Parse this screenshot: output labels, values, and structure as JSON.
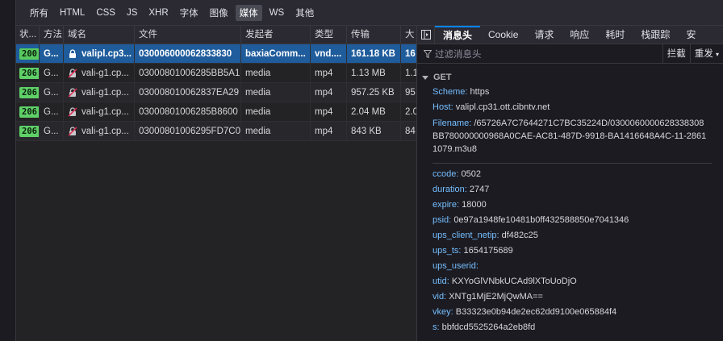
{
  "filters": [
    "所有",
    "HTML",
    "CSS",
    "JS",
    "XHR",
    "字体",
    "图像",
    "媒体",
    "WS",
    "其他"
  ],
  "active_filter": "媒体",
  "table": {
    "headers": [
      "状...",
      "方法",
      "域名",
      "文件",
      "发起者",
      "类型",
      "传输",
      "大"
    ],
    "rows": [
      {
        "status": "200",
        "method": "G...",
        "host": "valipl.cp3...",
        "file": "030006000062833830",
        "initiator": "baxiaComm...",
        "type": "vnd....",
        "transfer": "161.18 KB",
        "size": "16",
        "host_icon": "lock-icon",
        "selected": true
      },
      {
        "status": "206",
        "method": "G...",
        "host": "vali-g1.cp...",
        "file": "03000801006285BB5A1",
        "initiator": "media",
        "type": "mp4",
        "transfer": "1.13 MB",
        "size": "1.1",
        "host_icon": "insecure-lock-icon",
        "selected": false
      },
      {
        "status": "206",
        "method": "G...",
        "host": "vali-g1.cp...",
        "file": "030008010062837EA29",
        "initiator": "media",
        "type": "mp4",
        "transfer": "957.25 KB",
        "size": "95",
        "host_icon": "insecure-lock-icon",
        "selected": false
      },
      {
        "status": "206",
        "method": "G...",
        "host": "vali-g1.cp...",
        "file": "03000801006285B8600",
        "initiator": "media",
        "type": "mp4",
        "transfer": "2.04 MB",
        "size": "2.0",
        "host_icon": "insecure-lock-icon",
        "selected": false
      },
      {
        "status": "206",
        "method": "G...",
        "host": "vali-g1.cp...",
        "file": "03000801006295FD7C0",
        "initiator": "media",
        "type": "mp4",
        "transfer": "843 KB",
        "size": "84",
        "host_icon": "insecure-lock-icon",
        "selected": false
      }
    ]
  },
  "panel": {
    "tabs": [
      "消息头",
      "Cookie",
      "请求",
      "响应",
      "耗时",
      "栈跟踪",
      "安"
    ],
    "active_tab": "消息头",
    "search_placeholder": "过滤消息头",
    "block_label": "拦截",
    "resend_label": "重发",
    "section_title": "GET",
    "scheme": {
      "key": "Scheme:",
      "value": "https"
    },
    "host": {
      "key": "Host:",
      "value": "valipl.cp31.ott.cibntv.net"
    },
    "filename": {
      "key": "Filename:",
      "value": "/65726A7C7644271C7BC35224D/0300060000628338308BB780000000968A0CAE-AC81-487D-9918-BA1416648A4C-11-28611079.m3u8"
    },
    "params": [
      {
        "key": "ccode:",
        "value": "0502"
      },
      {
        "key": "duration:",
        "value": "2747"
      },
      {
        "key": "expire:",
        "value": "18000"
      },
      {
        "key": "psid:",
        "value": "0e97a1948fe10481b0ff432588850e7041346"
      },
      {
        "key": "ups_client_netip:",
        "value": "df482c25"
      },
      {
        "key": "ups_ts:",
        "value": "1654175689"
      },
      {
        "key": "ups_userid:",
        "value": ""
      },
      {
        "key": "utid:",
        "value": "KXYoGlVNbkUCAd9lXToUoDjO"
      },
      {
        "key": "vid:",
        "value": "XNTg1MjE2MjQwMA=="
      },
      {
        "key": "vkey:",
        "value": "B33323e0b94de2ec62dd9100e065884f4"
      },
      {
        "key": "s:",
        "value": "bbfdcd5525264a2eb8fd"
      }
    ]
  },
  "colors": {
    "accent": "#0a84ff",
    "selected_row": "#1f5c9c",
    "status_ok": "#5fd068",
    "key_text": "#75bfff"
  }
}
